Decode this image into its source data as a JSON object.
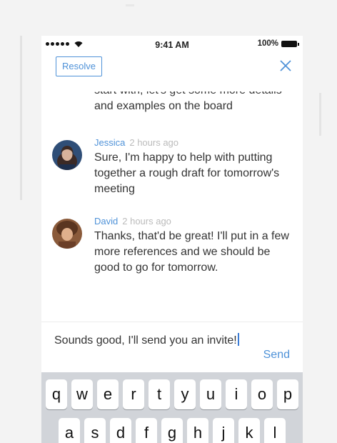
{
  "status_bar": {
    "time": "9:41 AM",
    "battery": "100%"
  },
  "header": {
    "resolve_label": "Resolve",
    "close_icon": "close-icon"
  },
  "thread": {
    "cutoff_text": "start with, let's get some more details and examples on the board",
    "messages": [
      {
        "author": "Jessica",
        "time": "2 hours ago",
        "text": "Sure, I'm happy to help with putting together a rough draft for tomorrow's meeting"
      },
      {
        "author": "David",
        "time": "2 hours ago",
        "text": "Thanks, that'd be great! I'll put in a few more references and we should be good to go for tomorrow."
      }
    ]
  },
  "composer": {
    "value": "Sounds good, I'll send you an invite!",
    "send_label": "Send"
  },
  "keyboard": {
    "row1": [
      "q",
      "w",
      "e",
      "r",
      "t",
      "y",
      "u",
      "i",
      "o",
      "p"
    ],
    "row2": [
      "a",
      "s",
      "d",
      "f",
      "g",
      "h",
      "j",
      "k",
      "l"
    ]
  },
  "colors": {
    "accent": "#4f92d8",
    "keyboard_bg": "#d1d4d9"
  }
}
